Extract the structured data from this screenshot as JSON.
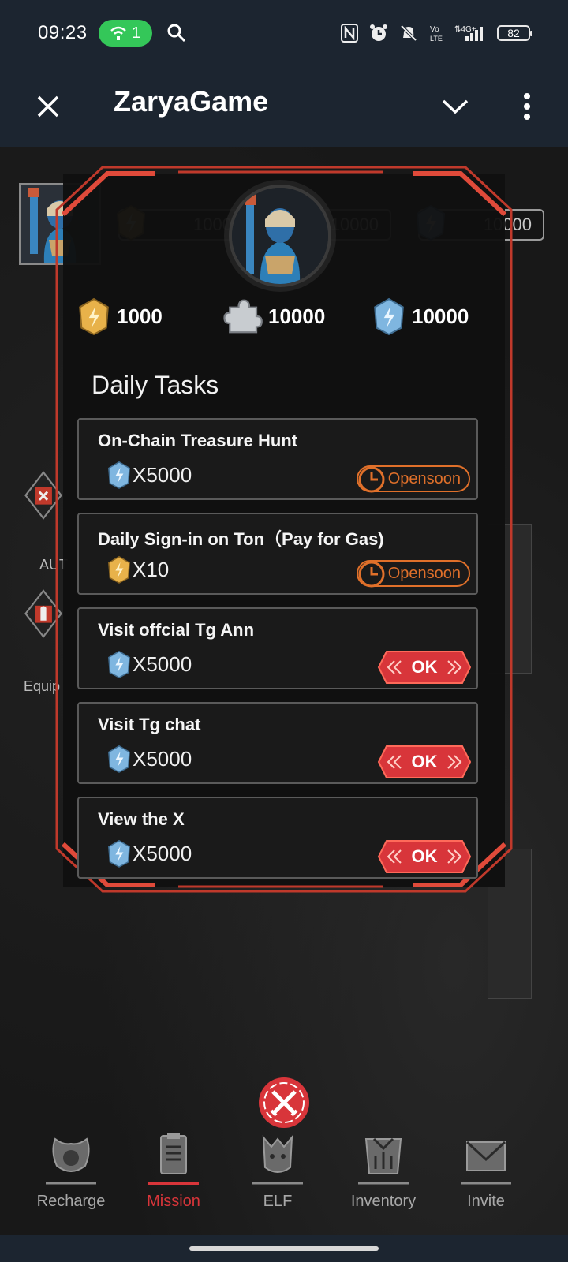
{
  "status_bar": {
    "time": "09:23",
    "hotspot_count": "1",
    "battery": "82",
    "icons": [
      "wifi-hotspot-icon",
      "search-icon",
      "nfc-icon",
      "alarm-icon",
      "mute-icon",
      "volte-icon",
      "signal-icon",
      "battery-icon"
    ]
  },
  "title_bar": {
    "title": "ZaryaGame",
    "icons": [
      "close-icon",
      "chevron-down-icon",
      "more-vertical-icon"
    ]
  },
  "top_resources": [
    {
      "icon": "gold-crystal-icon",
      "value": "1000"
    },
    {
      "icon": "puzzle-piece-icon",
      "value": "10000"
    },
    {
      "icon": "blue-crystal-icon",
      "value": "10000"
    }
  ],
  "side_labels": {
    "auto": "AUT",
    "equip": "Equip"
  },
  "dialog": {
    "currencies": [
      {
        "icon": "gold-crystal-icon",
        "value": "1000"
      },
      {
        "icon": "puzzle-piece-icon",
        "value": "10000"
      },
      {
        "icon": "blue-crystal-icon",
        "value": "10000"
      }
    ],
    "section_title": "Daily Tasks",
    "tasks": [
      {
        "name": "On-Chain Treasure Hunt",
        "reward_icon": "blue-crystal-icon",
        "reward": "X5000",
        "action": "Opensoon"
      },
      {
        "name": "Daily Sign-in on Ton（Pay for Gas)",
        "reward_icon": "gold-crystal-icon",
        "reward": "X10",
        "action": "Opensoon"
      },
      {
        "name": "Visit offcial Tg Ann",
        "reward_icon": "blue-crystal-icon",
        "reward": "X5000",
        "action": "OK"
      },
      {
        "name": "Visit Tg chat",
        "reward_icon": "blue-crystal-icon",
        "reward": "X5000",
        "action": "OK"
      },
      {
        "name": "View the X",
        "reward_icon": "blue-crystal-icon",
        "reward": "X5000",
        "action": "OK"
      }
    ]
  },
  "bottom_nav": [
    {
      "label": "Recharge",
      "icon": "recharge-icon",
      "active": false
    },
    {
      "label": "Mission",
      "icon": "mission-clipboard-icon",
      "active": true
    },
    {
      "label": "ELF",
      "icon": "elf-icon",
      "active": false
    },
    {
      "label": "Inventory",
      "icon": "inventory-icon",
      "active": false
    },
    {
      "label": "Invite",
      "icon": "invite-envelope-icon",
      "active": false
    }
  ],
  "colors": {
    "accent_red": "#d8353a",
    "opensoon_orange": "#e0702a",
    "bar_bg": "#1c2530",
    "gold": "#e8b24a",
    "crystal_blue": "#7fb6e0"
  }
}
